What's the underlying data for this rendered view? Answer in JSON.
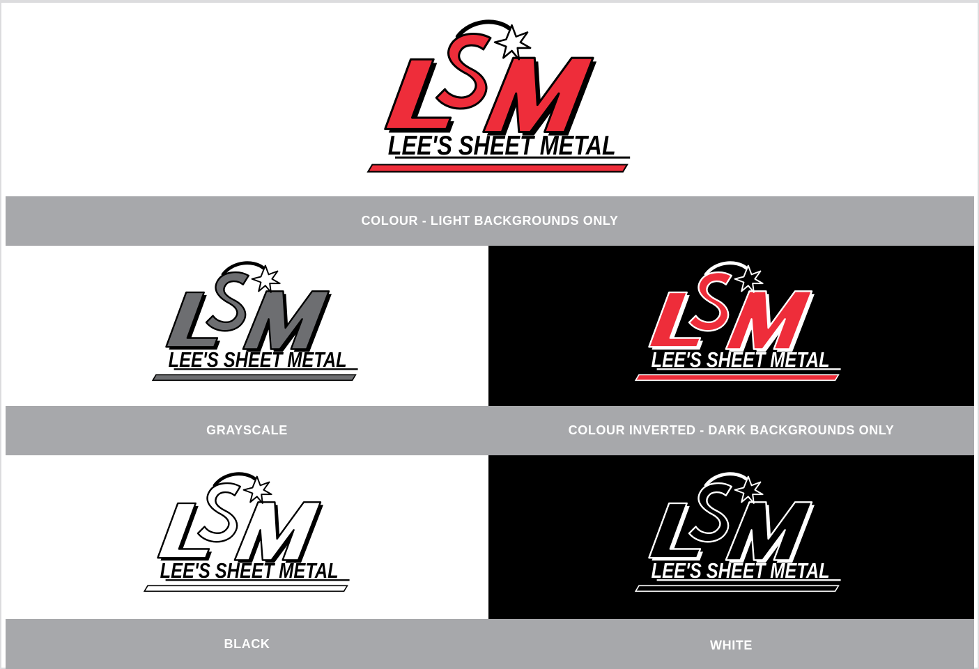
{
  "brand": {
    "monogram": "LSM",
    "wordmark": "LEE'S SHEET METAL",
    "colors": {
      "red": "#ee2d3a",
      "gray": "#6d6e71",
      "black": "#000000",
      "white": "#ffffff",
      "label_bar": "#a7a8ab"
    }
  },
  "variants": [
    {
      "id": "colour",
      "label": "COLOUR - LIGHT BACKGROUNDS ONLY",
      "background": "#ffffff"
    },
    {
      "id": "grayscale",
      "label": "GRAYSCALE",
      "background": "#ffffff"
    },
    {
      "id": "colour-inverted",
      "label": "COLOUR INVERTED - DARK BACKGROUNDS ONLY",
      "background": "#000000"
    },
    {
      "id": "black",
      "label": "BLACK",
      "background": "#ffffff"
    },
    {
      "id": "white",
      "label": "WHITE",
      "background": "#000000"
    }
  ]
}
